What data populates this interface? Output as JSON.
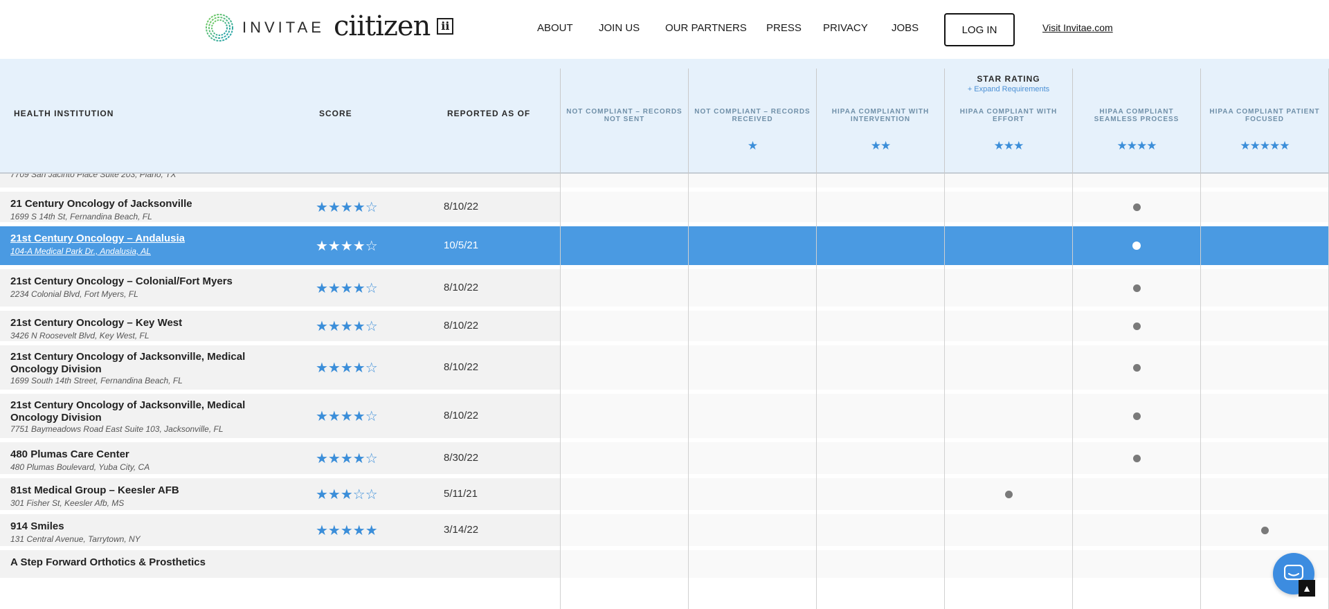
{
  "header": {
    "invitae_logo": "INVITAE",
    "ciitizen_logo": "ciitizen",
    "ciitizen_mark": "ii",
    "nav": [
      "ABOUT",
      "JOIN US",
      "OUR PARTNERS",
      "PRESS",
      "PRIVACY",
      "JOBS"
    ],
    "login_label": "LOG IN",
    "visit_link": "Visit Invitae.com"
  },
  "table_header": {
    "institution": "HEALTH INSTITUTION",
    "score": "SCORE",
    "reported": "REPORTED AS OF",
    "star_rating": "STAR RATING",
    "expand": "+ Expand Requirements",
    "columns": [
      {
        "label": "NOT COMPLIANT – RECORDS NOT SENT",
        "stars": ""
      },
      {
        "label": "NOT COMPLIANT – RECORDS RECEIVED",
        "stars": "★"
      },
      {
        "label": "HIPAA COMPLIANT WITH INTERVENTION",
        "stars": "★★"
      },
      {
        "label": "HIPAA COMPLIANT WITH EFFORT",
        "stars": "★★★"
      },
      {
        "label": "HIPAA COMPLIANT SEAMLESS PROCESS",
        "stars": "★★★★"
      },
      {
        "label": "HIPAA COMPLIANT PATIENT FOCUSED",
        "stars": "★★★★★"
      }
    ]
  },
  "partial_top_row": {
    "addr": "7709 San Jacinto Place Suite 203, Plano, TX"
  },
  "rows": [
    {
      "name": "21 Century Oncology of Jacksonville",
      "addr": "1699 S 14th St, Fernandina Beach, FL",
      "score": "★★★★☆",
      "date": "8/10/22",
      "col": 4
    },
    {
      "name": "21st Century Oncology – Andalusia",
      "addr": "104-A Medical Park Dr., Andalusia, AL",
      "score": "★★★★☆",
      "date": "10/5/21",
      "col": 4
    },
    {
      "name": "21st Century Oncology – Colonial/Fort Myers",
      "addr": "2234 Colonial Blvd, Fort Myers, FL",
      "score": "★★★★☆",
      "date": "8/10/22",
      "col": 4
    },
    {
      "name": "21st Century Oncology – Key West",
      "addr": "3426 N Roosevelt Blvd, Key West, FL",
      "score": "★★★★☆",
      "date": "8/10/22",
      "col": 4
    },
    {
      "name": "21st Century Oncology of Jacksonville, Medical Oncology Division",
      "addr": "1699 South 14th Street, Fernandina Beach, FL",
      "score": "★★★★☆",
      "date": "8/10/22",
      "col": 4
    },
    {
      "name": "21st Century Oncology of Jacksonville, Medical Oncology Division",
      "addr": "7751 Baymeadows Road East Suite 103, Jacksonville, FL",
      "score": "★★★★☆",
      "date": "8/10/22",
      "col": 4
    },
    {
      "name": "480 Plumas Care Center",
      "addr": "480 Plumas Boulevard, Yuba City, CA",
      "score": "★★★★☆",
      "date": "8/30/22",
      "col": 4
    },
    {
      "name": "81st Medical Group – Keesler AFB",
      "addr": "301 Fisher St, Keesler Afb, MS",
      "score": "★★★☆☆",
      "date": "5/11/21",
      "col": 3
    },
    {
      "name": "914 Smiles",
      "addr": "131 Central Avenue, Tarrytown, NY",
      "score": "★★★★★",
      "date": "3/14/22",
      "col": 5
    },
    {
      "name": "A Step Forward Orthotics & Prosthetics",
      "addr": "",
      "score": "",
      "date": "",
      "col": -1
    }
  ],
  "colors": {
    "accent": "#4a9ae2",
    "star": "#3b8ed9",
    "header_bg": "#e6f1fb"
  },
  "icons": {
    "chat": "chat-bubble-icon",
    "scroll": "arrow-up-icon"
  }
}
